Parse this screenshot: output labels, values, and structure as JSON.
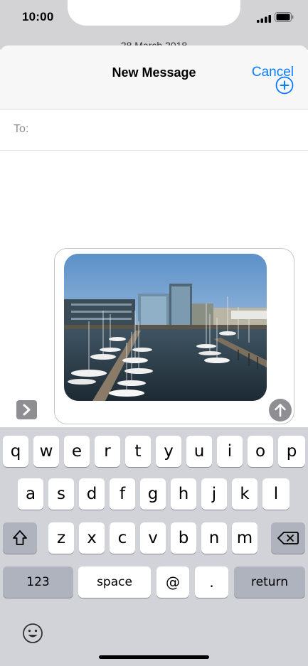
{
  "status": {
    "time": "10:00"
  },
  "background": {
    "date_fragment": "28 March 2018"
  },
  "header": {
    "title": "New Message",
    "cancel_label": "Cancel"
  },
  "recipient": {
    "label": "To:",
    "value": "",
    "placeholder": ""
  },
  "icons": {
    "add_contact": "plus-circle-icon",
    "expand": "chevron-right-icon",
    "send": "arrow-up-icon",
    "shift": "shift-icon",
    "delete": "backspace-icon",
    "emoji": "smiley-icon"
  },
  "colors": {
    "accent": "#0a7aff",
    "keyboard_bg": "#d1d3d9",
    "dark_key": "#aeb3be"
  },
  "keyboard": {
    "row1": [
      "q",
      "w",
      "e",
      "r",
      "t",
      "y",
      "u",
      "i",
      "o",
      "p"
    ],
    "row2": [
      "a",
      "s",
      "d",
      "f",
      "g",
      "h",
      "j",
      "k",
      "l"
    ],
    "row3": [
      "z",
      "x",
      "c",
      "v",
      "b",
      "n",
      "m"
    ],
    "numbers_label": "123",
    "space_label": "space",
    "at_label": "@",
    "dot_label": ".",
    "return_label": "return"
  }
}
